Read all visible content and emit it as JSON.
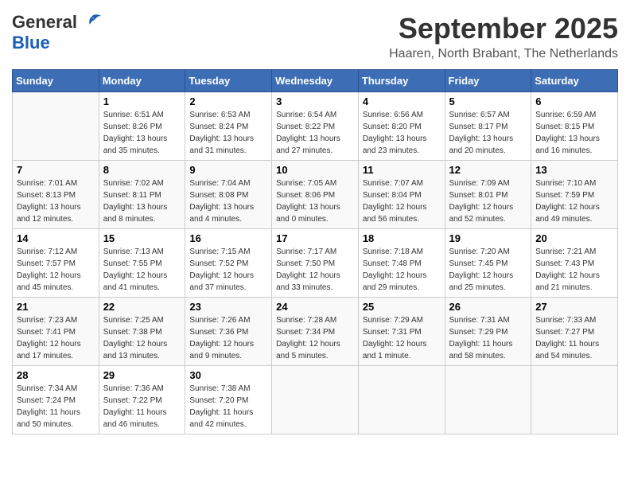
{
  "header": {
    "logo_general": "General",
    "logo_blue": "Blue",
    "month_title": "September 2025",
    "location": "Haaren, North Brabant, The Netherlands"
  },
  "weekdays": [
    "Sunday",
    "Monday",
    "Tuesday",
    "Wednesday",
    "Thursday",
    "Friday",
    "Saturday"
  ],
  "weeks": [
    [
      {
        "day": "",
        "sunrise": "",
        "sunset": "",
        "daylight": ""
      },
      {
        "day": "1",
        "sunrise": "Sunrise: 6:51 AM",
        "sunset": "Sunset: 8:26 PM",
        "daylight": "Daylight: 13 hours and 35 minutes."
      },
      {
        "day": "2",
        "sunrise": "Sunrise: 6:53 AM",
        "sunset": "Sunset: 8:24 PM",
        "daylight": "Daylight: 13 hours and 31 minutes."
      },
      {
        "day": "3",
        "sunrise": "Sunrise: 6:54 AM",
        "sunset": "Sunset: 8:22 PM",
        "daylight": "Daylight: 13 hours and 27 minutes."
      },
      {
        "day": "4",
        "sunrise": "Sunrise: 6:56 AM",
        "sunset": "Sunset: 8:20 PM",
        "daylight": "Daylight: 13 hours and 23 minutes."
      },
      {
        "day": "5",
        "sunrise": "Sunrise: 6:57 AM",
        "sunset": "Sunset: 8:17 PM",
        "daylight": "Daylight: 13 hours and 20 minutes."
      },
      {
        "day": "6",
        "sunrise": "Sunrise: 6:59 AM",
        "sunset": "Sunset: 8:15 PM",
        "daylight": "Daylight: 13 hours and 16 minutes."
      }
    ],
    [
      {
        "day": "7",
        "sunrise": "Sunrise: 7:01 AM",
        "sunset": "Sunset: 8:13 PM",
        "daylight": "Daylight: 13 hours and 12 minutes."
      },
      {
        "day": "8",
        "sunrise": "Sunrise: 7:02 AM",
        "sunset": "Sunset: 8:11 PM",
        "daylight": "Daylight: 13 hours and 8 minutes."
      },
      {
        "day": "9",
        "sunrise": "Sunrise: 7:04 AM",
        "sunset": "Sunset: 8:08 PM",
        "daylight": "Daylight: 13 hours and 4 minutes."
      },
      {
        "day": "10",
        "sunrise": "Sunrise: 7:05 AM",
        "sunset": "Sunset: 8:06 PM",
        "daylight": "Daylight: 13 hours and 0 minutes."
      },
      {
        "day": "11",
        "sunrise": "Sunrise: 7:07 AM",
        "sunset": "Sunset: 8:04 PM",
        "daylight": "Daylight: 12 hours and 56 minutes."
      },
      {
        "day": "12",
        "sunrise": "Sunrise: 7:09 AM",
        "sunset": "Sunset: 8:01 PM",
        "daylight": "Daylight: 12 hours and 52 minutes."
      },
      {
        "day": "13",
        "sunrise": "Sunrise: 7:10 AM",
        "sunset": "Sunset: 7:59 PM",
        "daylight": "Daylight: 12 hours and 49 minutes."
      }
    ],
    [
      {
        "day": "14",
        "sunrise": "Sunrise: 7:12 AM",
        "sunset": "Sunset: 7:57 PM",
        "daylight": "Daylight: 12 hours and 45 minutes."
      },
      {
        "day": "15",
        "sunrise": "Sunrise: 7:13 AM",
        "sunset": "Sunset: 7:55 PM",
        "daylight": "Daylight: 12 hours and 41 minutes."
      },
      {
        "day": "16",
        "sunrise": "Sunrise: 7:15 AM",
        "sunset": "Sunset: 7:52 PM",
        "daylight": "Daylight: 12 hours and 37 minutes."
      },
      {
        "day": "17",
        "sunrise": "Sunrise: 7:17 AM",
        "sunset": "Sunset: 7:50 PM",
        "daylight": "Daylight: 12 hours and 33 minutes."
      },
      {
        "day": "18",
        "sunrise": "Sunrise: 7:18 AM",
        "sunset": "Sunset: 7:48 PM",
        "daylight": "Daylight: 12 hours and 29 minutes."
      },
      {
        "day": "19",
        "sunrise": "Sunrise: 7:20 AM",
        "sunset": "Sunset: 7:45 PM",
        "daylight": "Daylight: 12 hours and 25 minutes."
      },
      {
        "day": "20",
        "sunrise": "Sunrise: 7:21 AM",
        "sunset": "Sunset: 7:43 PM",
        "daylight": "Daylight: 12 hours and 21 minutes."
      }
    ],
    [
      {
        "day": "21",
        "sunrise": "Sunrise: 7:23 AM",
        "sunset": "Sunset: 7:41 PM",
        "daylight": "Daylight: 12 hours and 17 minutes."
      },
      {
        "day": "22",
        "sunrise": "Sunrise: 7:25 AM",
        "sunset": "Sunset: 7:38 PM",
        "daylight": "Daylight: 12 hours and 13 minutes."
      },
      {
        "day": "23",
        "sunrise": "Sunrise: 7:26 AM",
        "sunset": "Sunset: 7:36 PM",
        "daylight": "Daylight: 12 hours and 9 minutes."
      },
      {
        "day": "24",
        "sunrise": "Sunrise: 7:28 AM",
        "sunset": "Sunset: 7:34 PM",
        "daylight": "Daylight: 12 hours and 5 minutes."
      },
      {
        "day": "25",
        "sunrise": "Sunrise: 7:29 AM",
        "sunset": "Sunset: 7:31 PM",
        "daylight": "Daylight: 12 hours and 1 minute."
      },
      {
        "day": "26",
        "sunrise": "Sunrise: 7:31 AM",
        "sunset": "Sunset: 7:29 PM",
        "daylight": "Daylight: 11 hours and 58 minutes."
      },
      {
        "day": "27",
        "sunrise": "Sunrise: 7:33 AM",
        "sunset": "Sunset: 7:27 PM",
        "daylight": "Daylight: 11 hours and 54 minutes."
      }
    ],
    [
      {
        "day": "28",
        "sunrise": "Sunrise: 7:34 AM",
        "sunset": "Sunset: 7:24 PM",
        "daylight": "Daylight: 11 hours and 50 minutes."
      },
      {
        "day": "29",
        "sunrise": "Sunrise: 7:36 AM",
        "sunset": "Sunset: 7:22 PM",
        "daylight": "Daylight: 11 hours and 46 minutes."
      },
      {
        "day": "30",
        "sunrise": "Sunrise: 7:38 AM",
        "sunset": "Sunset: 7:20 PM",
        "daylight": "Daylight: 11 hours and 42 minutes."
      },
      {
        "day": "",
        "sunrise": "",
        "sunset": "",
        "daylight": ""
      },
      {
        "day": "",
        "sunrise": "",
        "sunset": "",
        "daylight": ""
      },
      {
        "day": "",
        "sunrise": "",
        "sunset": "",
        "daylight": ""
      },
      {
        "day": "",
        "sunrise": "",
        "sunset": "",
        "daylight": ""
      }
    ]
  ]
}
